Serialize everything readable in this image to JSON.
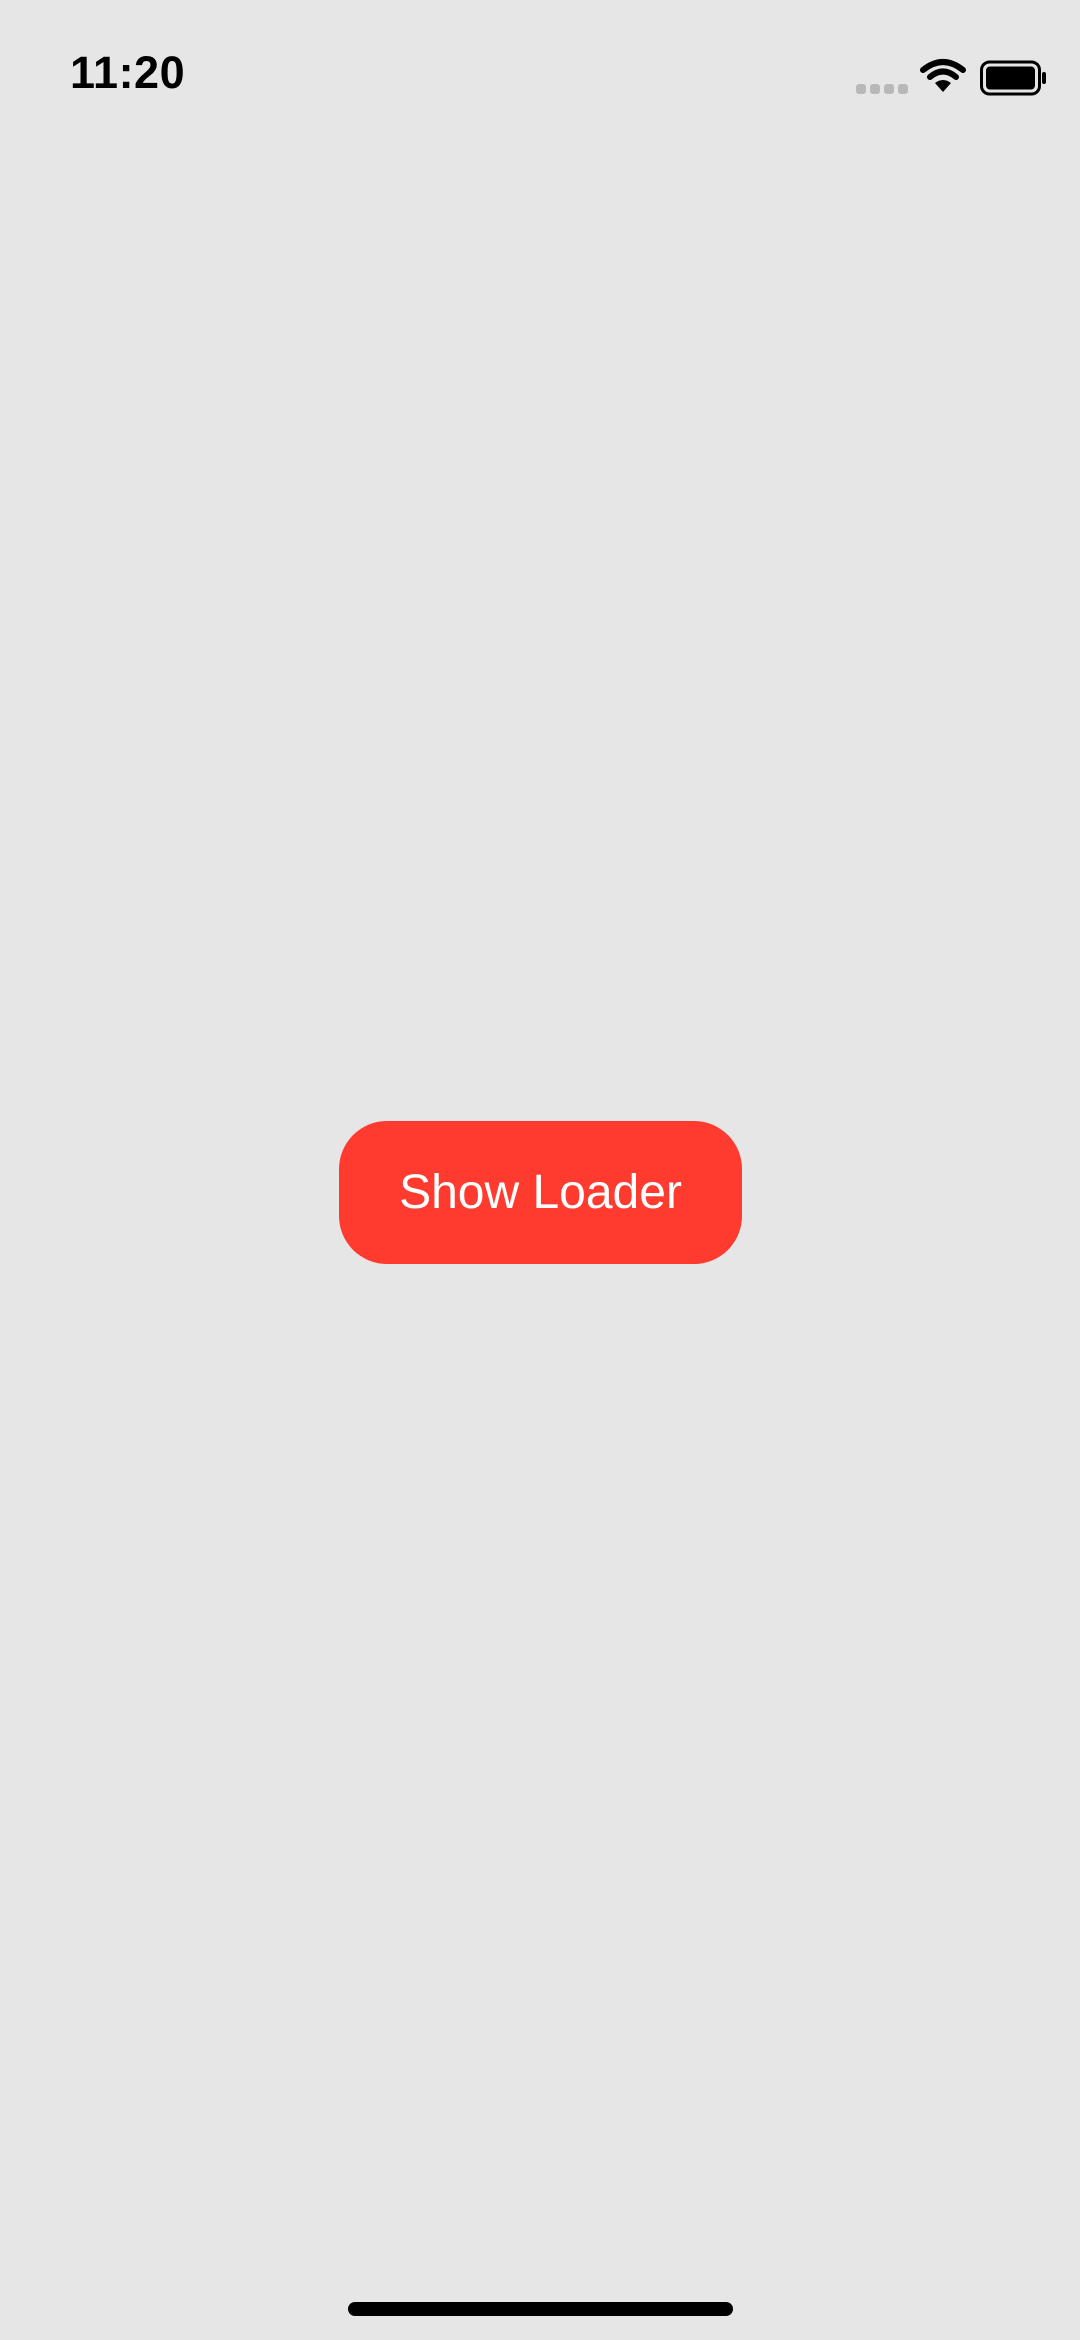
{
  "status_bar": {
    "time": "11:20",
    "icons": {
      "signal": "cellular-signal-icon",
      "wifi": "wifi-icon",
      "battery": "battery-icon"
    }
  },
  "main": {
    "show_loader_label": "Show Loader",
    "show_loader_color": "#ff3b30"
  },
  "colors": {
    "background": "#e6e6e6",
    "text_primary": "#000000",
    "button_text": "#ffffff"
  }
}
